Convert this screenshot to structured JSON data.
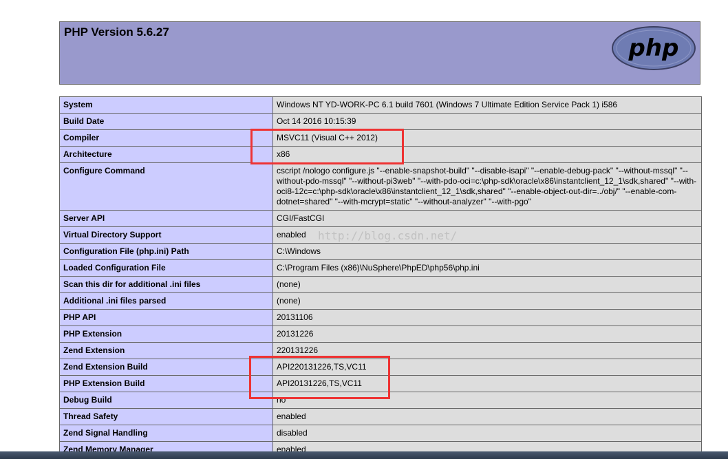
{
  "header": {
    "title": "PHP Version 5.6.27",
    "logo_text": "php"
  },
  "rows": [
    {
      "key": "System",
      "value": "Windows NT YD-WORK-PC 6.1 build 7601 (Windows 7 Ultimate Edition Service Pack 1) i586"
    },
    {
      "key": "Build Date",
      "value": "Oct 14 2016 10:15:39"
    },
    {
      "key": "Compiler",
      "value": "MSVC11 (Visual C++ 2012)"
    },
    {
      "key": "Architecture",
      "value": "x86"
    },
    {
      "key": "Configure Command",
      "value": "cscript /nologo configure.js \"--enable-snapshot-build\" \"--disable-isapi\" \"--enable-debug-pack\" \"--without-mssql\" \"--without-pdo-mssql\" \"--without-pi3web\" \"--with-pdo-oci=c:\\php-sdk\\oracle\\x86\\instantclient_12_1\\sdk,shared\" \"--with-oci8-12c=c:\\php-sdk\\oracle\\x86\\instantclient_12_1\\sdk,shared\" \"--enable-object-out-dir=../obj/\" \"--enable-com-dotnet=shared\" \"--with-mcrypt=static\" \"--without-analyzer\" \"--with-pgo\""
    },
    {
      "key": "Server API",
      "value": "CGI/FastCGI"
    },
    {
      "key": "Virtual Directory Support",
      "value": "enabled"
    },
    {
      "key": "Configuration File (php.ini) Path",
      "value": "C:\\Windows"
    },
    {
      "key": "Loaded Configuration File",
      "value": "C:\\Program Files (x86)\\NuSphere\\PhpED\\php56\\php.ini"
    },
    {
      "key": "Scan this dir for additional .ini files",
      "value": "(none)"
    },
    {
      "key": "Additional .ini files parsed",
      "value": "(none)"
    },
    {
      "key": "PHP API",
      "value": "20131106"
    },
    {
      "key": "PHP Extension",
      "value": "20131226"
    },
    {
      "key": "Zend Extension",
      "value": "220131226"
    },
    {
      "key": "Zend Extension Build",
      "value": "API220131226,TS,VC11"
    },
    {
      "key": "PHP Extension Build",
      "value": "API20131226,TS,VC11"
    },
    {
      "key": "Debug Build",
      "value": "no"
    },
    {
      "key": "Thread Safety",
      "value": "enabled"
    },
    {
      "key": "Zend Signal Handling",
      "value": "disabled"
    },
    {
      "key": "Zend Memory Manager",
      "value": "enabled"
    }
  ],
  "watermark": "http://blog.csdn.net/",
  "colors": {
    "header_bg": "#9999cc",
    "key_bg": "#ccccff",
    "value_bg": "#dddddd",
    "highlight": "#ee3333"
  }
}
